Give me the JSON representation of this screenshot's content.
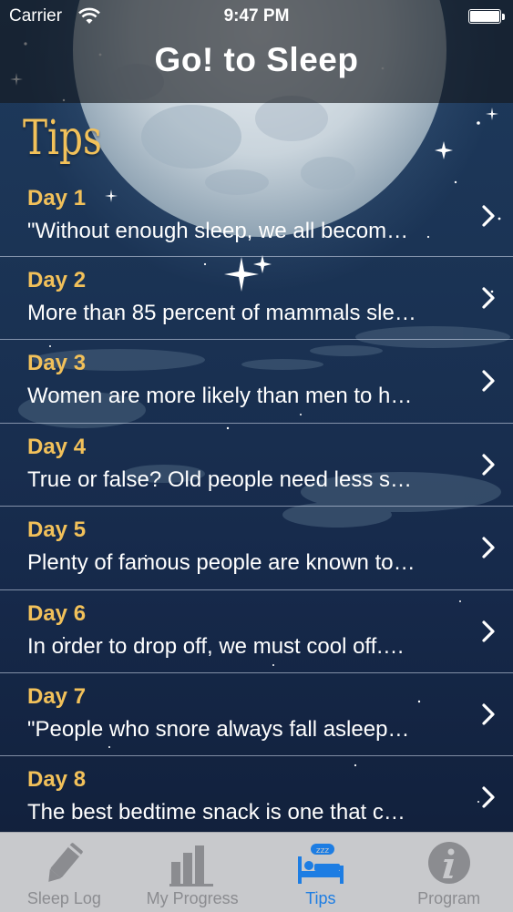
{
  "status_bar": {
    "carrier": "Carrier",
    "time": "9:47 PM"
  },
  "nav": {
    "title": "Go! to Sleep"
  },
  "section": {
    "heading": "Tips"
  },
  "tips": [
    {
      "day": "Day 1",
      "text": "\"Without enough sleep, we all becom…"
    },
    {
      "day": "Day 2",
      "text": "More than 85 percent of mammals sle…"
    },
    {
      "day": "Day 3",
      "text": "Women are more likely than men to h…"
    },
    {
      "day": "Day 4",
      "text": "True or false? Old people need less s…"
    },
    {
      "day": "Day 5",
      "text": "Plenty of famous people are known to…"
    },
    {
      "day": "Day 6",
      "text": "In order to drop off, we must cool off.…"
    },
    {
      "day": "Day 7",
      "text": "\"People who snore always fall asleep…"
    },
    {
      "day": "Day 8",
      "text": "The best bedtime snack is one that c…"
    }
  ],
  "tab_bar": {
    "tabs": [
      {
        "label": "Sleep Log",
        "icon": "pencil-icon",
        "active": false
      },
      {
        "label": "My Progress",
        "icon": "bar-chart-icon",
        "active": false
      },
      {
        "label": "Tips",
        "icon": "bed-zzz-icon",
        "active": true
      },
      {
        "label": "Program",
        "icon": "info-icon",
        "active": false
      }
    ]
  },
  "colors": {
    "accent": "#f2c15a",
    "active_tab": "#1d7de3",
    "inactive_tab": "#8b8c90"
  }
}
